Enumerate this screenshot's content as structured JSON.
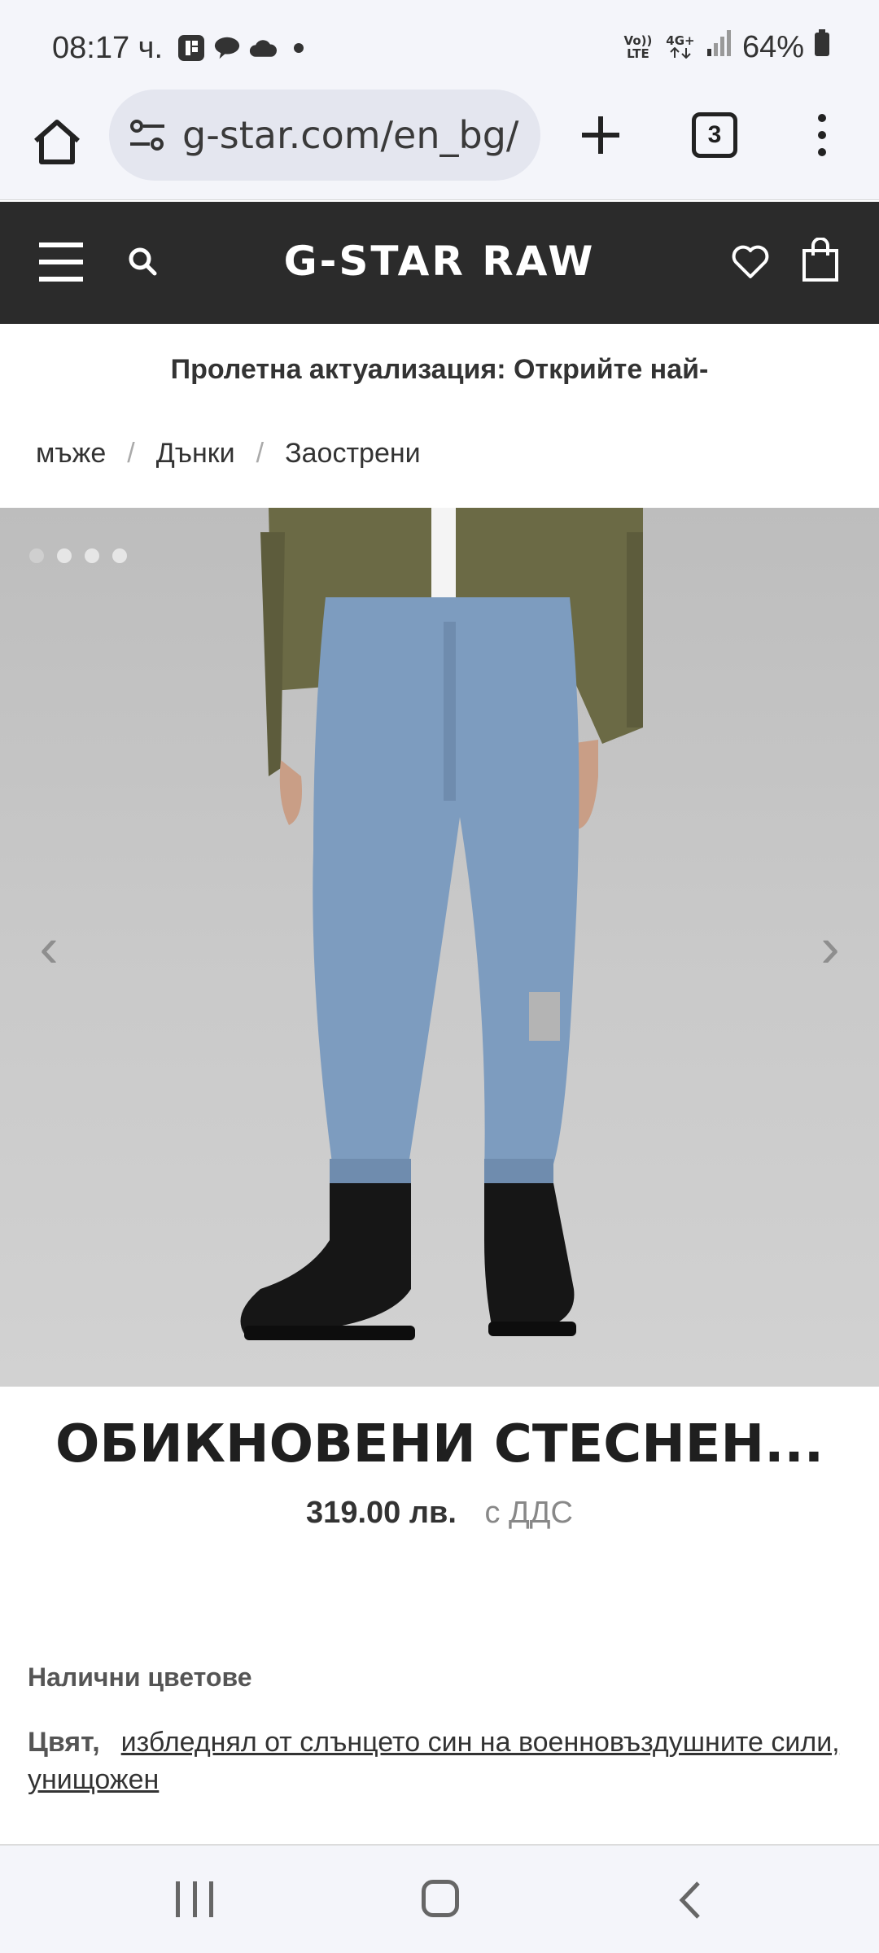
{
  "status_bar": {
    "time": "08:17 ч.",
    "network_label_1": "Vo)) LTE",
    "network_label_2": "4G+",
    "battery": "64%"
  },
  "browser": {
    "url": "g-star.com/en_bg/",
    "tab_count": "3"
  },
  "site_header": {
    "brand": "G-STAR RAW"
  },
  "promo": {
    "text": "Пролетна актуализация: Открийте най-"
  },
  "breadcrumb": {
    "items": [
      "мъже",
      "Дънки",
      "Заострени"
    ],
    "separator": "/"
  },
  "gallery": {
    "prev_label": "‹",
    "next_label": "›"
  },
  "product": {
    "title": "ОБИКНОВЕНИ СТЕСНЕН...",
    "price": "319.00 лв.",
    "vat_note": "с ДДС",
    "colors_heading": "Налични цветове",
    "color_label": "Цвят,",
    "color_value": "избледнял от слънцето син на военновъздушните сили, унищожен"
  },
  "colors": {
    "header_bg": "#2b2b2b",
    "jacket": "#6b6a45",
    "denim": "#7d9cbf"
  }
}
